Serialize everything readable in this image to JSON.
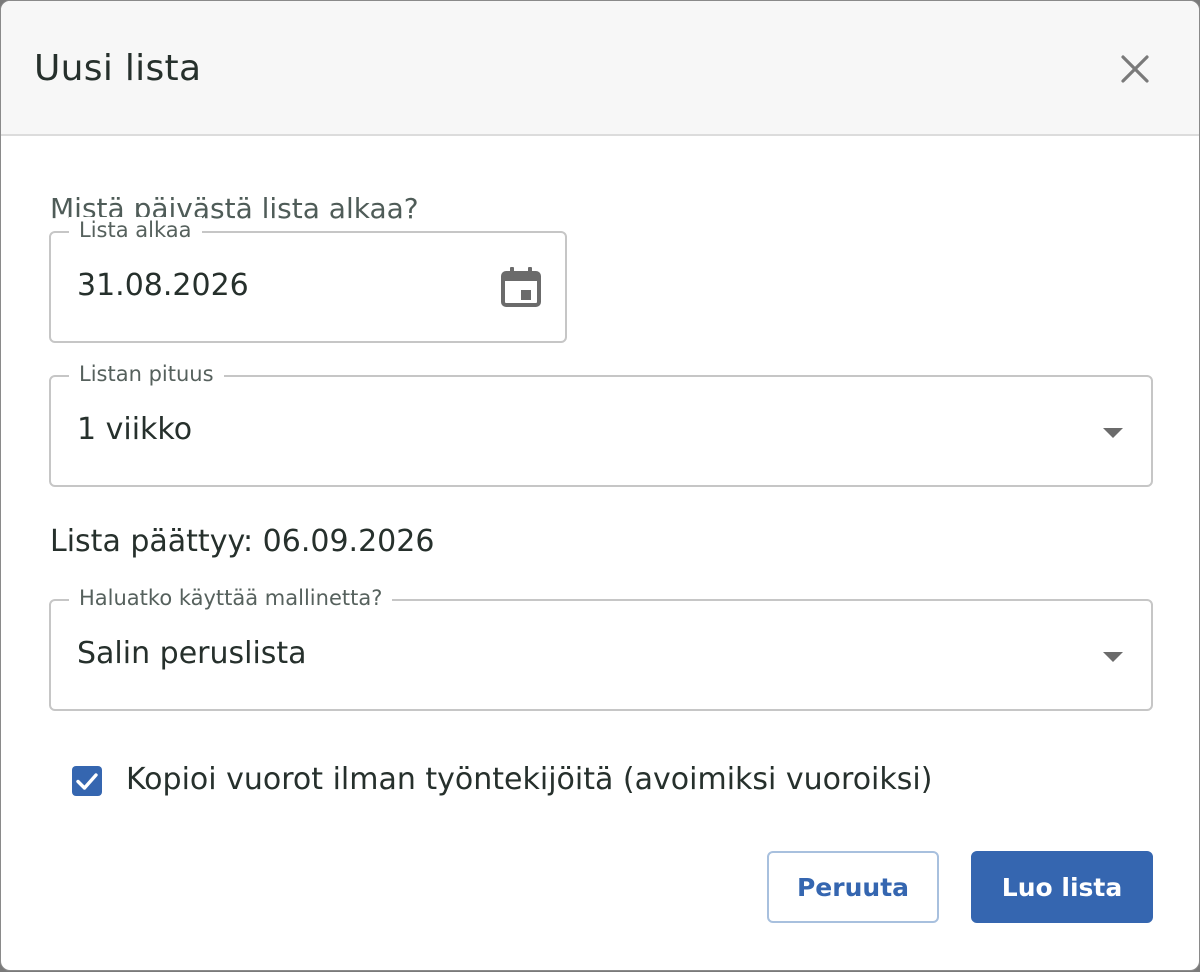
{
  "dialog": {
    "title": "Uusi lista",
    "close_icon": "close-icon"
  },
  "form": {
    "question": "Mistä päivästä lista alkaa?",
    "start_date": {
      "label": "Lista alkaa",
      "value": "31.08.2026",
      "icon": "calendar-icon"
    },
    "length": {
      "label": "Listan pituus",
      "value": "1 viikko",
      "icon": "chevron-down-icon"
    },
    "end_text": "Lista päättyy: 06.09.2026",
    "template": {
      "label": "Haluatko käyttää mallinetta?",
      "value": "Salin peruslista",
      "icon": "chevron-down-icon"
    },
    "copy_shifts": {
      "label": "Kopioi vuorot ilman työntekijöitä (avoimiksi vuoroiksi)",
      "checked": true
    }
  },
  "buttons": {
    "cancel_label": "Peruuta",
    "create_label": "Luo lista"
  },
  "colors": {
    "accent": "#3566b0",
    "text": "#26302c",
    "header_bg": "#f7f7f7"
  }
}
